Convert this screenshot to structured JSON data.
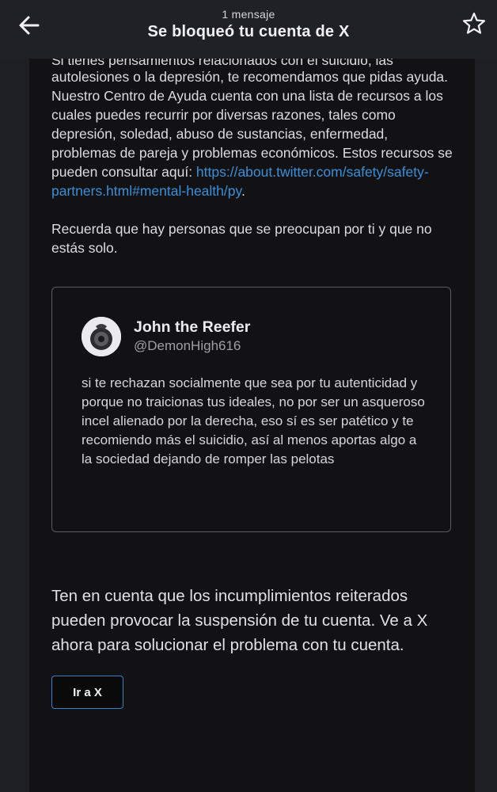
{
  "header": {
    "subtitle": "1 mensaje",
    "title": "Se bloqueó tu cuenta de X",
    "back_icon": "arrow-left-icon",
    "star_icon": "star-outline-icon"
  },
  "email": {
    "clipped_line": "Si tienes pensamientos relacionados con el suicidio, las",
    "paragraph1": "autolesiones o la depresión, te recomendamos que pidas ayuda. Nuestro Centro de Ayuda cuenta con una lista de recursos a los cuales puedes recurrir por diversas razones, tales como depresión, soledad, abuso de sustancias, enfermedad, problemas de pareja y problemas económicos. Estos recursos se pueden consultar aquí: ",
    "link": "https://about.twitter.com/safety/safety-partners.html#mental-health/py",
    "link_suffix": ".",
    "paragraph2": "Recuerda que hay personas que se preocupan por ti y que no estás solo.",
    "tweet": {
      "name": "John the Reefer",
      "handle": "@DemonHigh616",
      "text": "si te rechazan socialmente que sea por tu autenticidad y porque no traicionas tus ideales, no por ser un asqueroso incel alienado por la derecha, eso sí es ser patético y te recomiendo más el suicidio, así al menos aportas algo a la sociedad dejando de romper las pelotas"
    },
    "warning": "Ten en cuenta que los incumplimientos reiterados pueden provocar la suspensión de tu cuenta. Ve a X ahora para solucionar el problema con tu cuenta.",
    "cta_label": "Ir a X"
  },
  "colors": {
    "background": "#1e1f24",
    "panel": "#121214",
    "link": "#3a8fd8",
    "button_border": "#3a7fc4"
  }
}
